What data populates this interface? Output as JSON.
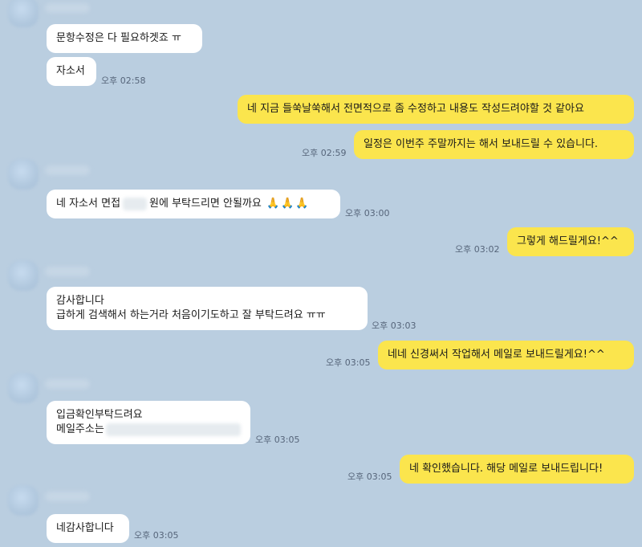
{
  "messages": [
    {
      "side": "in",
      "lines": [
        "문항수정은 다 필요하겟죠 ㅠ"
      ],
      "time": ""
    },
    {
      "side": "in",
      "lines": [
        "자소서"
      ],
      "time": "오후 02:58"
    },
    {
      "side": "out",
      "lines": [
        "네 지금 들쑥날쑥해서 전면적으로 좀 수정하고 내용도 작성드려야할 것 같아요"
      ],
      "time": ""
    },
    {
      "side": "out",
      "lines": [
        "일정은 이번주 주말까지는 해서 보내드릴 수 있습니다."
      ],
      "time": "오후 02:59"
    },
    {
      "side": "in",
      "pre": "네 자소서 면접",
      "post": "원에 부탁드리면 안될까요",
      "emoji": "🙏",
      "time": "오후 03:00"
    },
    {
      "side": "out",
      "lines": [
        "그렇게 해드릴게요!^^"
      ],
      "time": "오후 03:02"
    },
    {
      "side": "in",
      "lines": [
        "감사합니다",
        "급하게 검색해서 하는거라 처음이기도하고 잘 부탁드려요 ㅠㅠ"
      ],
      "time": "오후 03:03"
    },
    {
      "side": "out",
      "lines": [
        "네네 신경써서 작업해서 메일로 보내드릴게요!^^"
      ],
      "time": "오후 03:05"
    },
    {
      "side": "in",
      "lines": [
        "입금확인부탁드려요"
      ],
      "line2_prefix": "메일주소는",
      "time": "오후 03:05"
    },
    {
      "side": "out",
      "lines": [
        "네 확인했습니다. 해당 메일로 보내드립니다!"
      ],
      "time": "오후 03:05"
    },
    {
      "side": "in",
      "lines": [
        "네감사합니다"
      ],
      "time": "오후 03:05"
    }
  ],
  "colors": {
    "background": "#bacee0",
    "incoming": "#ffffff",
    "outgoing": "#fbe54d",
    "time": "#56657a"
  }
}
